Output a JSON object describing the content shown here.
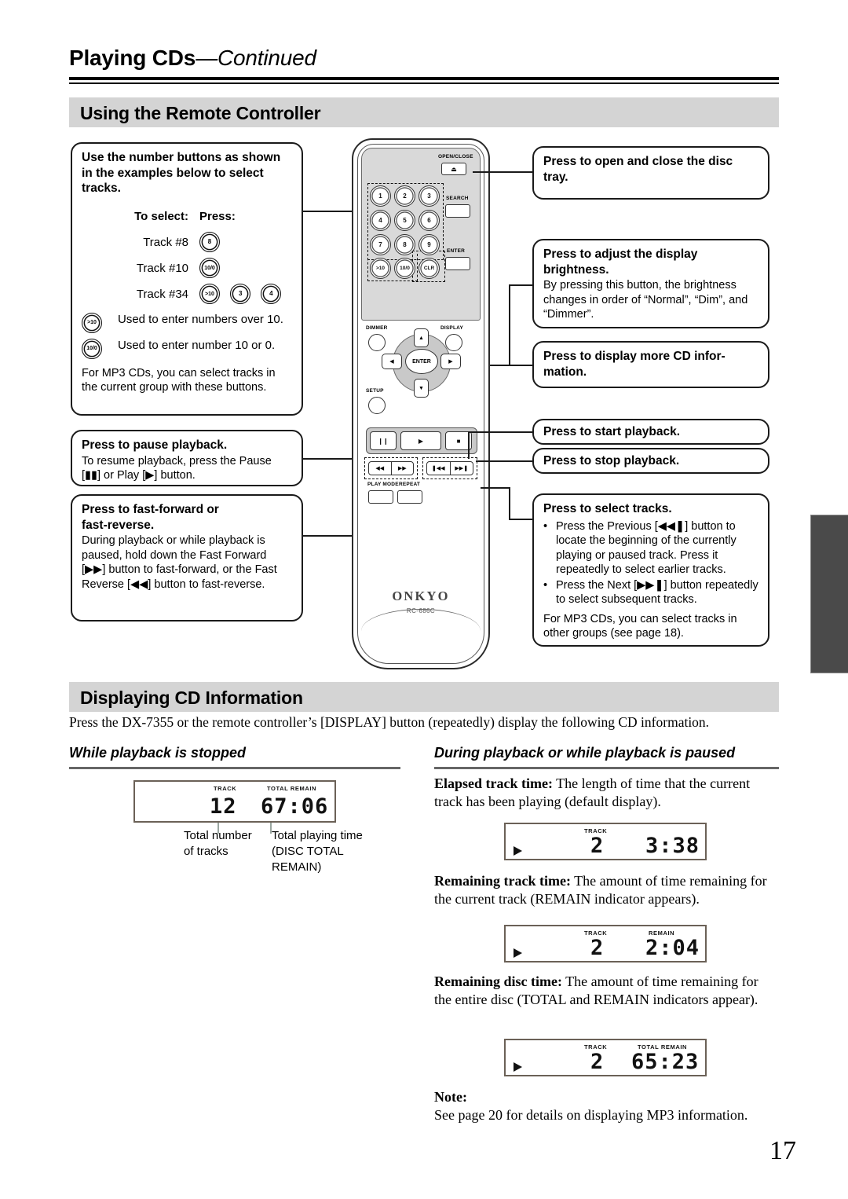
{
  "header": {
    "title": "Playing CDs",
    "continued": "—Continued"
  },
  "sections": {
    "remote": "Using the Remote Controller",
    "display": "Displaying CD Information"
  },
  "callouts": {
    "numbers": {
      "heading": "Use the number buttons as shown in the examples below to select tracks.",
      "col_headers": {
        "select": "To select:",
        "press": "Press:"
      },
      "rows": [
        {
          "label": "Track #8",
          "buttons": [
            "8"
          ]
        },
        {
          "label": "Track #10",
          "buttons": [
            "10/0"
          ]
        },
        {
          "label": "Track #34",
          "buttons": [
            ">10",
            "3",
            "4"
          ]
        }
      ],
      "legend": [
        {
          "button": ">10",
          "text": "Used to enter numbers over 10."
        },
        {
          "button": "10/0",
          "text": "Used to enter number 10 or 0."
        }
      ],
      "note": "For MP3 CDs, you can select tracks in the current group with these buttons."
    },
    "pause": {
      "heading": "Press to pause playback.",
      "body_a": "To resume playback, press the Pause",
      "body_b": "[▮▮] or Play [▶] button."
    },
    "ffrev": {
      "heading_l1": "Press to fast-forward or",
      "heading_l2": "fast-reverse.",
      "body": "During playback or while playback is paused, hold down the Fast Forward [▶▶] button to fast-forward, or the Fast Reverse [◀◀] button to fast-reverse."
    },
    "opentray": {
      "heading": "Press to open and close the disc tray."
    },
    "brightness": {
      "heading": "Press to adjust the display brightness.",
      "body": "By pressing this button, the brightness changes in order of “Normal”, “Dim”, and “Dimmer”."
    },
    "moreinfo": {
      "heading": "Press to display more CD infor-mation."
    },
    "startplay": {
      "heading": "Press to start playback."
    },
    "stopplay": {
      "heading": "Press to stop playback."
    },
    "selecttracks": {
      "heading": "Press to select tracks.",
      "bullets": [
        "Press the Previous [◀◀❚] button to locate the beginning of the currently playing or paused track. Press it repeatedly to select earlier tracks.",
        "Press the Next [▶▶❚] button repeatedly to select subsequent tracks."
      ],
      "note": "For MP3 CDs, you can select tracks in other groups (see page 18)."
    }
  },
  "remote": {
    "brand": "ONKYO",
    "model": "RC-686C",
    "labels": {
      "open_close": "OPEN/CLOSE",
      "search": "SEARCH",
      "enter_side": "ENTER",
      "dimmer": "DIMMER",
      "display": "DISPLAY",
      "setup": "SETUP",
      "enter_center": "ENTER",
      "play_mode": "PLAY MODE",
      "repeat": "REPEAT"
    },
    "number_keys": [
      "1",
      "2",
      "3",
      "4",
      "5",
      "6",
      "7",
      "8",
      "9",
      ">10",
      "10/0",
      "CLR"
    ],
    "eject_glyph": "⏏",
    "transport": {
      "pause": "❙❙",
      "play": "▶",
      "stop": "■"
    },
    "skip": {
      "rev": "◀◀",
      "fwd": "▶▶",
      "prev": "❚◀◀",
      "next": "▶▶❚"
    },
    "dpad": {
      "up": "▲",
      "down": "▼",
      "left": "◀",
      "right": "▶"
    }
  },
  "display_section": {
    "intro": "Press the DX-7355 or the remote controller’s [DISPLAY] button (repeatedly) display the following CD information.",
    "left_subhead": "While playback is stopped",
    "right_subhead": "During playback or while playback is paused",
    "stopped_lcd": {
      "indicator_track": "TRACK",
      "indicator_total_remain": "TOTAL REMAIN",
      "track_value": "12",
      "time_value": "67:06"
    },
    "captions": {
      "total_tracks_l1": "Total number",
      "total_tracks_l2": "of tracks",
      "total_time_l1": "Total playing time",
      "total_time_l2": "(DISC TOTAL",
      "total_time_l3": "REMAIN)"
    },
    "items": [
      {
        "term": "Elapsed track time:",
        "text": " The length of time that the current track has been playing (default display).",
        "lcd": {
          "indicators": [
            "TRACK"
          ],
          "track_value": "2",
          "time_value": "3:38"
        }
      },
      {
        "term": "Remaining track time:",
        "text": " The amount of time remaining for the current track (REMAIN indicator appears).",
        "lcd": {
          "indicators": [
            "TRACK",
            "REMAIN"
          ],
          "track_value": "2",
          "time_value": "2:04"
        }
      },
      {
        "term": "Remaining disc time:",
        "text": " The amount of time remaining for the entire disc (TOTAL and REMAIN indicators appear).",
        "lcd": {
          "indicators": [
            "TRACK",
            "TOTAL REMAIN"
          ],
          "track_value": "2",
          "time_value": "65:23"
        }
      }
    ],
    "note_label": "Note:",
    "note_text": "See page 20 for details on displaying MP3 information."
  },
  "page_number": "17"
}
